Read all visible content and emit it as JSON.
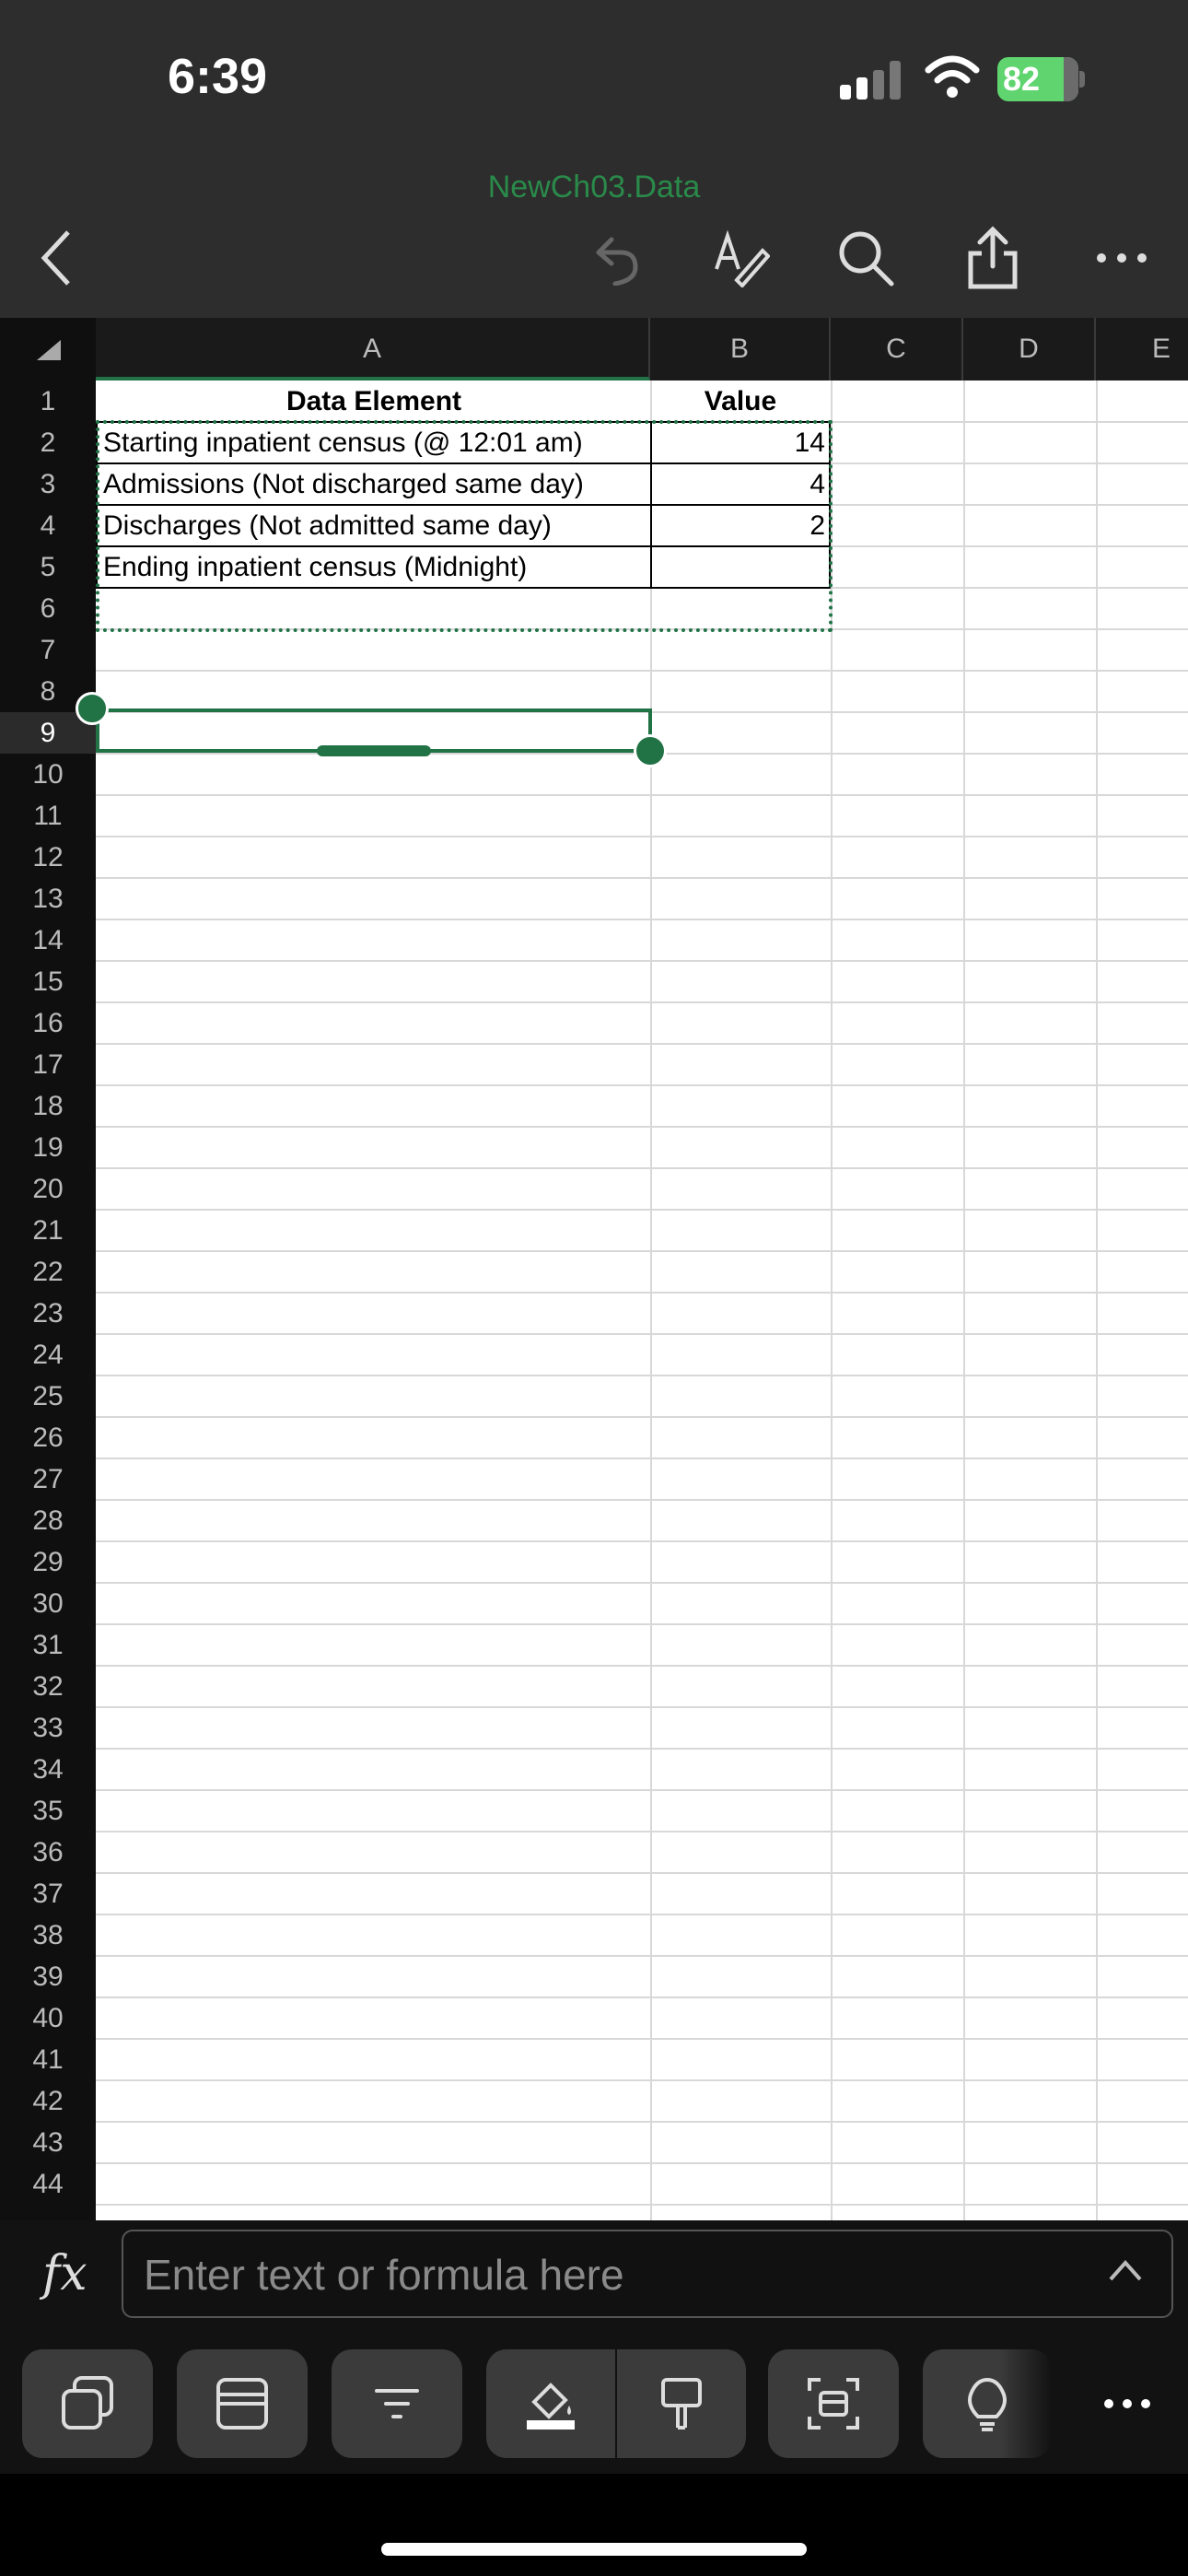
{
  "status_bar": {
    "time": "6:39",
    "battery": "82"
  },
  "toolbar": {
    "doc_title": "NewCh03.Data"
  },
  "columns": [
    "A",
    "B",
    "C",
    "D",
    "E"
  ],
  "rows": [
    "1",
    "2",
    "3",
    "4",
    "5",
    "6",
    "7",
    "8",
    "9",
    "10",
    "11",
    "12",
    "13",
    "14",
    "15",
    "16",
    "17",
    "18",
    "19",
    "20",
    "21",
    "22",
    "23",
    "24",
    "25",
    "26",
    "27",
    "28",
    "29",
    "30",
    "31",
    "32",
    "33",
    "34",
    "35",
    "36",
    "37",
    "38",
    "39",
    "40",
    "41",
    "42",
    "43",
    "44"
  ],
  "sheet": {
    "a1": "Data Element",
    "b1": "Value",
    "a2": "Starting inpatient census (@ 12:01 am)",
    "b2": "14",
    "a3": "Admissions (Not discharged same day)",
    "b3": "4",
    "a4": "Discharges (Not admitted same day)",
    "b4": "2",
    "a5": "Ending inpatient census (Midnight)",
    "b5": ""
  },
  "formula_bar": {
    "label": "fx",
    "placeholder": "Enter text or formula here",
    "value": ""
  },
  "accent_color": "#217346",
  "bottom_tools": [
    "copy-icon",
    "freeze-panes-icon",
    "filter-icon",
    "fill-color-icon",
    "format-painter-icon",
    "select-range-icon",
    "ideas-lightbulb-icon",
    "more-icon"
  ]
}
